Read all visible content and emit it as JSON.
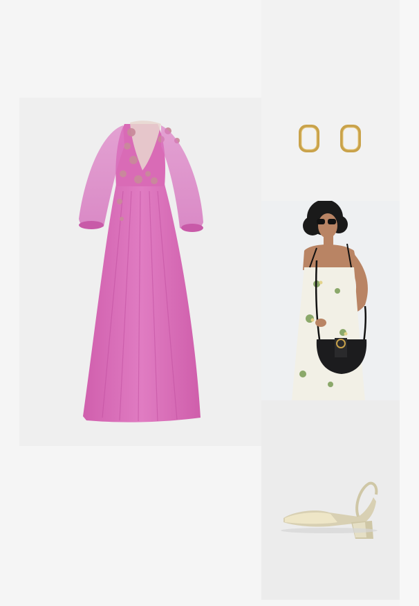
{
  "products": [
    {
      "id": "dress",
      "kind": "product-image",
      "name": "pink-tulle-maxi-dress",
      "color": "#d66db5"
    },
    {
      "id": "earrings",
      "kind": "product-image",
      "name": "gold-hoop-earrings",
      "color": "#c9a24a"
    },
    {
      "id": "bag",
      "kind": "product-image",
      "name": "black-crossbody-saddle-bag",
      "color": "#1c1c1e"
    },
    {
      "id": "shoes",
      "kind": "product-image",
      "name": "gold-metallic-slingback-heels",
      "color": "#cfc7a6"
    }
  ],
  "colors": {
    "page_bg": "#f5f5f5",
    "dress_pink": "#d66db5",
    "dress_lace": "#c98a9b",
    "gold": "#c9a24a",
    "bag_black": "#1c1c1e",
    "floral_green": "#8ba86a"
  }
}
